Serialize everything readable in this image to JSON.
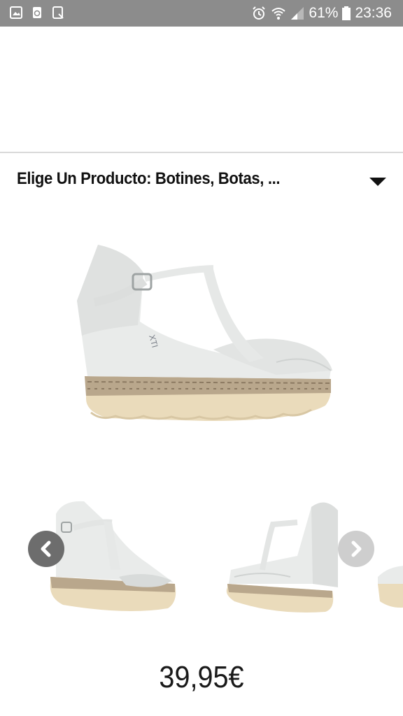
{
  "status_bar": {
    "battery": "61%",
    "time": "23:36",
    "left_icons": [
      "gallery-icon",
      "recycle-icon",
      "download-icon"
    ],
    "right_icons": [
      "alarm-icon",
      "wifi-icon",
      "signal-icon",
      "battery-icon"
    ]
  },
  "product_selector": {
    "label": "Elige Un Producto: Botines, Botas, ...",
    "icon": "caret-down-icon"
  },
  "carousel": {
    "prev_icon": "chevron-left-icon",
    "next_icon": "chevron-right-icon"
  },
  "product": {
    "price": "39,95€",
    "brand_mark": "XTI"
  },
  "colors": {
    "status_bar": "#8c8c8c",
    "shoe_upper": "#e9ebea",
    "sole": "#eadbbb",
    "braid": "#9b8a73"
  }
}
